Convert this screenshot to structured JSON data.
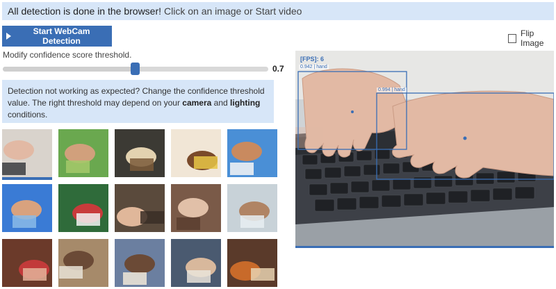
{
  "banner": {
    "bold_text": "All detection is done in the browser!",
    "rest_text": "Click on an image or Start video"
  },
  "controls": {
    "start_button_label": "Start WebCam Detection",
    "flip_label": "Flip Image",
    "flip_checked": false,
    "threshold_label": "Modify confidence score threshold.",
    "threshold_value": "0.7",
    "threshold_fraction": 0.7
  },
  "notice": {
    "part1": "Detection not working as expected? Change the confidence threshold value. The right threshold may depend on your ",
    "bold1": "camera",
    "part2": " and ",
    "bold2": "lighting",
    "part3": " conditions."
  },
  "gallery": {
    "selected_index": 0,
    "images": [
      {
        "name": "typing-hands-image"
      },
      {
        "name": "holding-hands-image"
      },
      {
        "name": "chess-hand-image"
      },
      {
        "name": "smiling-girl-image"
      },
      {
        "name": "raised-hands-image"
      },
      {
        "name": "waving-hands-image"
      },
      {
        "name": "red-cup-hands-image"
      },
      {
        "name": "clasped-hands-image"
      },
      {
        "name": "hands-on-table-image"
      },
      {
        "name": "pointing-hand-image"
      },
      {
        "name": "coffee-mug-hands-image"
      },
      {
        "name": "father-child-reading-image"
      },
      {
        "name": "boy-writing-image"
      },
      {
        "name": "child-writing-image"
      },
      {
        "name": "bracelet-hands-image"
      }
    ]
  },
  "detection": {
    "fps_text": "[FPS]: 6",
    "labels": [
      "0.942 | hand",
      "0.994 | hand"
    ]
  },
  "colors": {
    "accent": "#3a6eb5",
    "banner_bg": "#d7e6f8"
  }
}
